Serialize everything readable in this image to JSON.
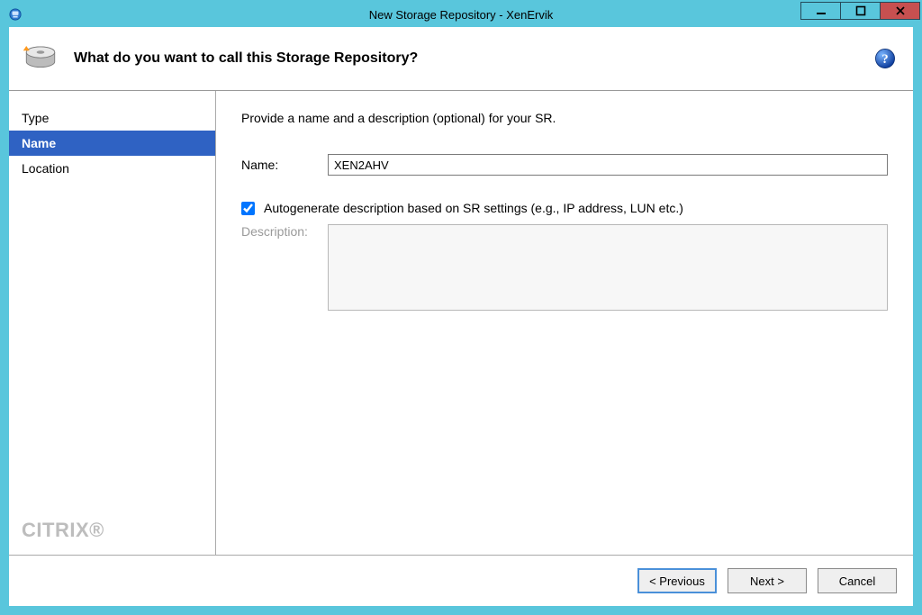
{
  "window": {
    "title": "New Storage Repository - XenErvik"
  },
  "header": {
    "heading": "What do you want to call this Storage Repository?"
  },
  "sidebar": {
    "items": [
      {
        "label": "Type",
        "active": false
      },
      {
        "label": "Name",
        "active": true
      },
      {
        "label": "Location",
        "active": false
      }
    ],
    "brand": "CITRIX"
  },
  "content": {
    "intro": "Provide a name and a description (optional) for your SR.",
    "name_label": "Name:",
    "name_value": "XEN2AHV",
    "autogen_label": "Autogenerate description based on SR settings (e.g., IP address, LUN etc.)",
    "autogen_checked": true,
    "description_label": "Description:",
    "description_value": ""
  },
  "footer": {
    "previous": "< Previous",
    "next": "Next >",
    "cancel": "Cancel"
  }
}
